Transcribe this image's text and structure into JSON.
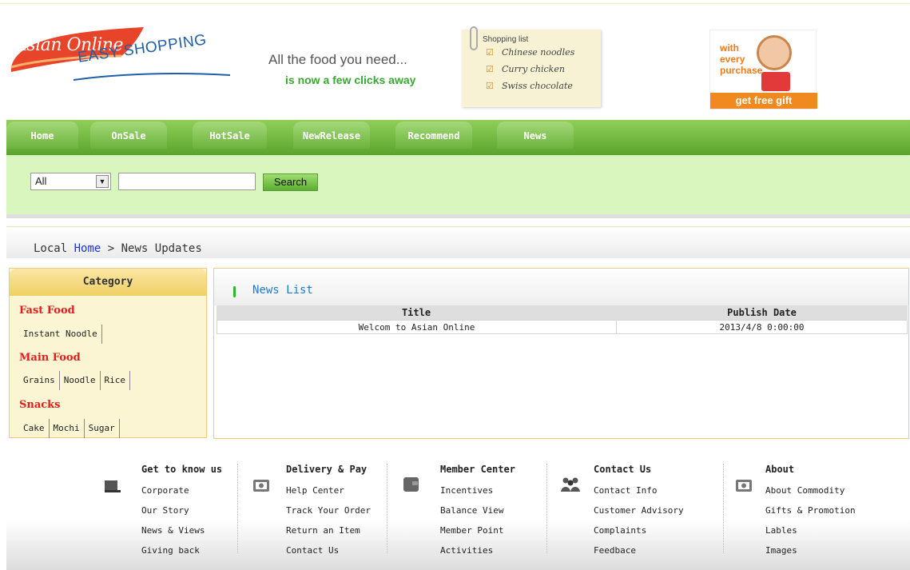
{
  "header": {
    "logo_text": "Asian Online",
    "logo_sub": "EASY SHOPPING",
    "slogan_line1": "All the food you need...",
    "slogan_line2": "is now a few clicks away",
    "shopping_list": {
      "title": "Shopping list",
      "items": [
        "Chinese noodles",
        "Curry chicken",
        "Swiss chocolate"
      ]
    },
    "gift": {
      "line1": "with",
      "line2": "every",
      "line3": "purchase",
      "bar": "get free gift"
    }
  },
  "nav": {
    "tabs": [
      "Home",
      "OnSale",
      "HotSale",
      "NewRelease",
      "Recommend",
      "News"
    ]
  },
  "search": {
    "category_selected": "All",
    "input_value": "",
    "button_label": "Search"
  },
  "breadcrumb": {
    "prefix": "Local",
    "home_link": "Home",
    "separator": ">",
    "current": "News Updates"
  },
  "sidebar": {
    "title": "Category",
    "categories": [
      {
        "name": "Fast Food",
        "subs": [
          "Instant Noodle"
        ]
      },
      {
        "name": "Main Food",
        "subs": [
          "Grains",
          "Noodle",
          "Rice"
        ]
      },
      {
        "name": "Snacks",
        "subs": [
          "Cake",
          "Mochi",
          "Sugar"
        ]
      }
    ]
  },
  "news": {
    "title": "News List",
    "columns": [
      "Title",
      "Publish Date"
    ],
    "rows": [
      {
        "title": "Welcom to Asian Online",
        "date": "2013/4/8 0:00:00"
      }
    ]
  },
  "footer": {
    "columns": [
      {
        "icon": "cart-icon",
        "title": "Get to know us",
        "items": [
          "Corporate",
          "Our Story",
          "News & Views",
          "Giving back"
        ]
      },
      {
        "icon": "card-icon",
        "title": "Delivery & Pay",
        "items": [
          "Help Center",
          "Track Your Order",
          "Return an Item",
          "Contact Us"
        ]
      },
      {
        "icon": "wallet-icon",
        "title": "Member Center",
        "items": [
          "Incentives",
          "Balance View",
          "Member Point",
          "Activities"
        ]
      },
      {
        "icon": "people-icon",
        "title": "Contact Us",
        "items": [
          "Contact Info",
          "Customer Advisory",
          "Complaints",
          "Feedbace"
        ]
      },
      {
        "icon": "card-icon",
        "title": "About",
        "items": [
          "About Commodity",
          "Gifts & Promotion",
          "Lables",
          "Images"
        ]
      }
    ]
  },
  "colors": {
    "nav_green": "#6cb33c",
    "search_band": "#d9f6bf",
    "category_red": "#e31d1d",
    "link_blue": "#1a33d6",
    "news_title_blue": "#1f7bd1"
  }
}
